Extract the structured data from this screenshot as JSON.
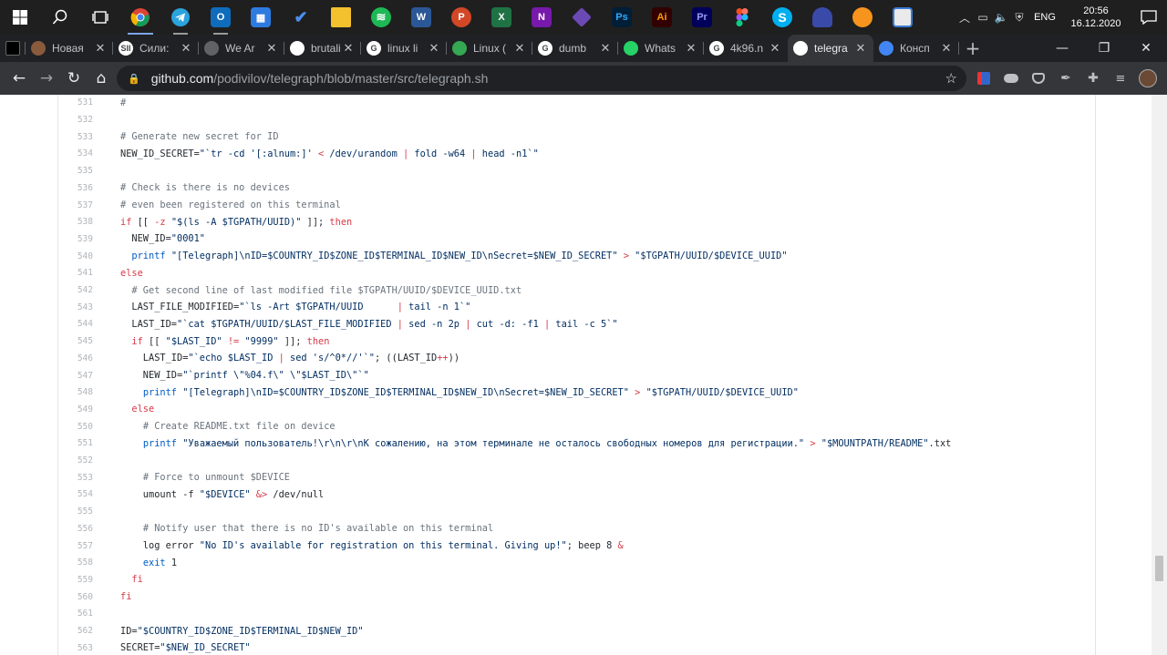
{
  "taskbar": {
    "apps": [
      {
        "name": "start",
        "label": "",
        "color": "#1f1f1f"
      },
      {
        "name": "search",
        "label": "",
        "color": "#1f1f1f"
      },
      {
        "name": "task-view",
        "label": "",
        "color": "#1f1f1f"
      },
      {
        "name": "chrome",
        "label": "",
        "color": "#4285f4"
      },
      {
        "name": "telegram",
        "label": "",
        "color": "#2aa3de"
      },
      {
        "name": "outlook",
        "label": "O",
        "color": "#0f6cbd"
      },
      {
        "name": "calendar",
        "label": "",
        "color": "#2d7be0"
      },
      {
        "name": "todo",
        "label": "",
        "color": "#2b7ce9"
      },
      {
        "name": "file-explorer",
        "label": "",
        "color": "#f3c12d"
      },
      {
        "name": "spotify",
        "label": "",
        "color": "#1db954"
      },
      {
        "name": "word",
        "label": "W",
        "color": "#2b5797"
      },
      {
        "name": "powerpoint",
        "label": "P",
        "color": "#d24726"
      },
      {
        "name": "excel",
        "label": "X",
        "color": "#1f7244"
      },
      {
        "name": "onenote",
        "label": "N",
        "color": "#7719aa"
      },
      {
        "name": "obsidian",
        "label": "",
        "color": "#6c4ab6"
      },
      {
        "name": "photoshop",
        "label": "Ps",
        "color": "#001e36"
      },
      {
        "name": "illustrator",
        "label": "Ai",
        "color": "#330000"
      },
      {
        "name": "premiere",
        "label": "Pr",
        "color": "#00005b"
      },
      {
        "name": "figma",
        "label": "",
        "color": "#a259ff"
      },
      {
        "name": "skype",
        "label": "S",
        "color": "#00aff0"
      },
      {
        "name": "app-bowl",
        "label": "",
        "color": "#3a4aa8"
      },
      {
        "name": "fl-studio",
        "label": "",
        "color": "#f7941d"
      },
      {
        "name": "notepad",
        "label": "",
        "color": "#3a7bd5"
      }
    ],
    "lang": "ENG",
    "time": "20:56",
    "date": "16.12.2020"
  },
  "tabs": [
    {
      "label": "",
      "fav_color": "#000000",
      "fav_text": ""
    },
    {
      "label": "Новая",
      "fav_color": "#8a5a3c",
      "fav_text": ""
    },
    {
      "label": "Сили:",
      "fav_color": "#ffffff",
      "fav_text": "SII"
    },
    {
      "label": "We Ar",
      "fav_color": "#5f6368",
      "fav_text": ""
    },
    {
      "label": "brutali",
      "fav_color": "#ffffff",
      "fav_text": ""
    },
    {
      "label": "linux li",
      "fav_color": "#ffffff",
      "fav_text": "G"
    },
    {
      "label": "Linux (",
      "fav_color": "#34a853",
      "fav_text": ""
    },
    {
      "label": "dumb",
      "fav_color": "#ffffff",
      "fav_text": "G"
    },
    {
      "label": "Whats",
      "fav_color": "#25d366",
      "fav_text": ""
    },
    {
      "label": "4k96.n",
      "fav_color": "#ffffff",
      "fav_text": "G"
    },
    {
      "label": "telegra",
      "fav_color": "#ffffff",
      "fav_text": ""
    },
    {
      "label": "Консп",
      "fav_color": "#4285f4",
      "fav_text": ""
    }
  ],
  "omnibox": {
    "host": "github.com",
    "path": "/podivilov/telegraph/blob/master/src/telegraph.sh"
  },
  "code_lines": [
    {
      "n": "531",
      "tokens": [
        {
          "c": "cm",
          "t": "#"
        }
      ]
    },
    {
      "n": "532",
      "tokens": []
    },
    {
      "n": "533",
      "tokens": [
        {
          "c": "cm",
          "t": "# Generate new secret for ID"
        }
      ]
    },
    {
      "n": "534",
      "tokens": [
        {
          "c": "",
          "t": "NEW_ID_SECRET="
        },
        {
          "c": "str",
          "t": "\"`tr -cd '[:alnum:]' "
        },
        {
          "c": "kw",
          "t": "<"
        },
        {
          "c": "str",
          "t": " /dev/urandom "
        },
        {
          "c": "kw",
          "t": "|"
        },
        {
          "c": "str",
          "t": " fold -w64 "
        },
        {
          "c": "kw",
          "t": "|"
        },
        {
          "c": "str",
          "t": " head -n1`\""
        }
      ]
    },
    {
      "n": "535",
      "tokens": []
    },
    {
      "n": "536",
      "tokens": [
        {
          "c": "cm",
          "t": "# Check is there is no devices"
        }
      ]
    },
    {
      "n": "537",
      "tokens": [
        {
          "c": "cm",
          "t": "# even been registered on this terminal"
        }
      ]
    },
    {
      "n": "538",
      "tokens": [
        {
          "c": "kw",
          "t": "if"
        },
        {
          "c": "",
          "t": " [[ "
        },
        {
          "c": "kw",
          "t": "-z"
        },
        {
          "c": "",
          "t": " "
        },
        {
          "c": "str",
          "t": "\"$(ls -A $TGPATH/UUID)\""
        },
        {
          "c": "",
          "t": " ]]; "
        },
        {
          "c": "kw",
          "t": "then"
        }
      ]
    },
    {
      "n": "539",
      "tokens": [
        {
          "c": "",
          "t": "  NEW_ID="
        },
        {
          "c": "str",
          "t": "\"0001\""
        }
      ]
    },
    {
      "n": "540",
      "tokens": [
        {
          "c": "",
          "t": "  "
        },
        {
          "c": "fn",
          "t": "printf"
        },
        {
          "c": "",
          "t": " "
        },
        {
          "c": "str",
          "t": "\"[Telegraph]\\nID=$COUNTRY_ID$ZONE_ID$TERMINAL_ID$NEW_ID\\nSecret=$NEW_ID_SECRET\""
        },
        {
          "c": "",
          "t": " "
        },
        {
          "c": "kw",
          "t": ">"
        },
        {
          "c": "",
          "t": " "
        },
        {
          "c": "str",
          "t": "\"$TGPATH/UUID/$DEVICE_UUID\""
        }
      ]
    },
    {
      "n": "541",
      "tokens": [
        {
          "c": "kw",
          "t": "else"
        }
      ]
    },
    {
      "n": "542",
      "tokens": [
        {
          "c": "",
          "t": "  "
        },
        {
          "c": "cm",
          "t": "# Get second line of last modified file $TGPATH/UUID/$DEVICE_UUID.txt"
        }
      ]
    },
    {
      "n": "543",
      "tokens": [
        {
          "c": "",
          "t": "  LAST_FILE_MODIFIED="
        },
        {
          "c": "str",
          "t": "\"`ls -Art $TGPATH/UUID      "
        },
        {
          "c": "kw",
          "t": "|"
        },
        {
          "c": "str",
          "t": " tail -n 1`\""
        }
      ]
    },
    {
      "n": "544",
      "tokens": [
        {
          "c": "",
          "t": "  LAST_ID="
        },
        {
          "c": "str",
          "t": "\"`cat $TGPATH/UUID/$LAST_FILE_MODIFIED "
        },
        {
          "c": "kw",
          "t": "|"
        },
        {
          "c": "str",
          "t": " sed -n 2p "
        },
        {
          "c": "kw",
          "t": "|"
        },
        {
          "c": "str",
          "t": " cut -d: -f1 "
        },
        {
          "c": "kw",
          "t": "|"
        },
        {
          "c": "str",
          "t": " tail -c 5`\""
        }
      ]
    },
    {
      "n": "545",
      "tokens": [
        {
          "c": "",
          "t": "  "
        },
        {
          "c": "kw",
          "t": "if"
        },
        {
          "c": "",
          "t": " [[ "
        },
        {
          "c": "str",
          "t": "\"$LAST_ID\""
        },
        {
          "c": "",
          "t": " "
        },
        {
          "c": "kw",
          "t": "!="
        },
        {
          "c": "",
          "t": " "
        },
        {
          "c": "str",
          "t": "\"9999\""
        },
        {
          "c": "",
          "t": " ]]; "
        },
        {
          "c": "kw",
          "t": "then"
        }
      ]
    },
    {
      "n": "546",
      "tokens": [
        {
          "c": "",
          "t": "    LAST_ID="
        },
        {
          "c": "str",
          "t": "\"`echo $LAST_ID "
        },
        {
          "c": "kw",
          "t": "|"
        },
        {
          "c": "str",
          "t": " sed 's/^0*//'`\""
        },
        {
          "c": "",
          "t": "; ((LAST_ID"
        },
        {
          "c": "kw",
          "t": "++"
        },
        {
          "c": "",
          "t": "))"
        }
      ]
    },
    {
      "n": "547",
      "tokens": [
        {
          "c": "",
          "t": "    NEW_ID="
        },
        {
          "c": "str",
          "t": "\"`printf \\\"%04.f\\\" \\\"$LAST_ID\\\"`\""
        }
      ]
    },
    {
      "n": "548",
      "tokens": [
        {
          "c": "",
          "t": "    "
        },
        {
          "c": "fn",
          "t": "printf"
        },
        {
          "c": "",
          "t": " "
        },
        {
          "c": "str",
          "t": "\"[Telegraph]\\nID=$COUNTRY_ID$ZONE_ID$TERMINAL_ID$NEW_ID\\nSecret=$NEW_ID_SECRET\""
        },
        {
          "c": "",
          "t": " "
        },
        {
          "c": "kw",
          "t": ">"
        },
        {
          "c": "",
          "t": " "
        },
        {
          "c": "str",
          "t": "\"$TGPATH/UUID/$DEVICE_UUID\""
        }
      ]
    },
    {
      "n": "549",
      "tokens": [
        {
          "c": "",
          "t": "  "
        },
        {
          "c": "kw",
          "t": "else"
        }
      ]
    },
    {
      "n": "550",
      "tokens": [
        {
          "c": "",
          "t": "    "
        },
        {
          "c": "cm",
          "t": "# Create README.txt file on device"
        }
      ]
    },
    {
      "n": "551",
      "tokens": [
        {
          "c": "",
          "t": "    "
        },
        {
          "c": "fn",
          "t": "printf"
        },
        {
          "c": "",
          "t": " "
        },
        {
          "c": "str",
          "t": "\"Уважаемый пользователь!\\r\\n\\r\\nК сожалению, на этом терминале не осталось свободных номеров для регистрации.\""
        },
        {
          "c": "",
          "t": " "
        },
        {
          "c": "kw",
          "t": ">"
        },
        {
          "c": "",
          "t": " "
        },
        {
          "c": "str",
          "t": "\"$MOUNTPATH/README\""
        },
        {
          "c": "",
          "t": ".txt"
        }
      ]
    },
    {
      "n": "552",
      "tokens": []
    },
    {
      "n": "553",
      "tokens": [
        {
          "c": "",
          "t": "    "
        },
        {
          "c": "cm",
          "t": "# Force to unmount $DEVICE"
        }
      ]
    },
    {
      "n": "554",
      "tokens": [
        {
          "c": "",
          "t": "    umount -f "
        },
        {
          "c": "str",
          "t": "\"$DEVICE\""
        },
        {
          "c": "",
          "t": " "
        },
        {
          "c": "kw",
          "t": "&>"
        },
        {
          "c": "",
          "t": " /dev/null"
        }
      ]
    },
    {
      "n": "555",
      "tokens": []
    },
    {
      "n": "556",
      "tokens": [
        {
          "c": "",
          "t": "    "
        },
        {
          "c": "cm",
          "t": "# Notify user that there is no ID's available on this terminal"
        }
      ]
    },
    {
      "n": "557",
      "tokens": [
        {
          "c": "",
          "t": "    log error "
        },
        {
          "c": "str",
          "t": "\"No ID's available for registration on this terminal. Giving up!\""
        },
        {
          "c": "",
          "t": "; beep 8 "
        },
        {
          "c": "kw",
          "t": "&"
        }
      ]
    },
    {
      "n": "558",
      "tokens": [
        {
          "c": "",
          "t": "    "
        },
        {
          "c": "fn",
          "t": "exit"
        },
        {
          "c": "",
          "t": " 1"
        }
      ]
    },
    {
      "n": "559",
      "tokens": [
        {
          "c": "",
          "t": "  "
        },
        {
          "c": "kw",
          "t": "fi"
        }
      ]
    },
    {
      "n": "560",
      "tokens": [
        {
          "c": "kw",
          "t": "fi"
        }
      ]
    },
    {
      "n": "561",
      "tokens": []
    },
    {
      "n": "562",
      "tokens": [
        {
          "c": "",
          "t": "ID="
        },
        {
          "c": "str",
          "t": "\"$COUNTRY_ID$ZONE_ID$TERMINAL_ID$NEW_ID\""
        }
      ]
    },
    {
      "n": "563",
      "tokens": [
        {
          "c": "",
          "t": "SECRET="
        },
        {
          "c": "str",
          "t": "\"$NEW_ID_SECRET\""
        }
      ]
    }
  ]
}
